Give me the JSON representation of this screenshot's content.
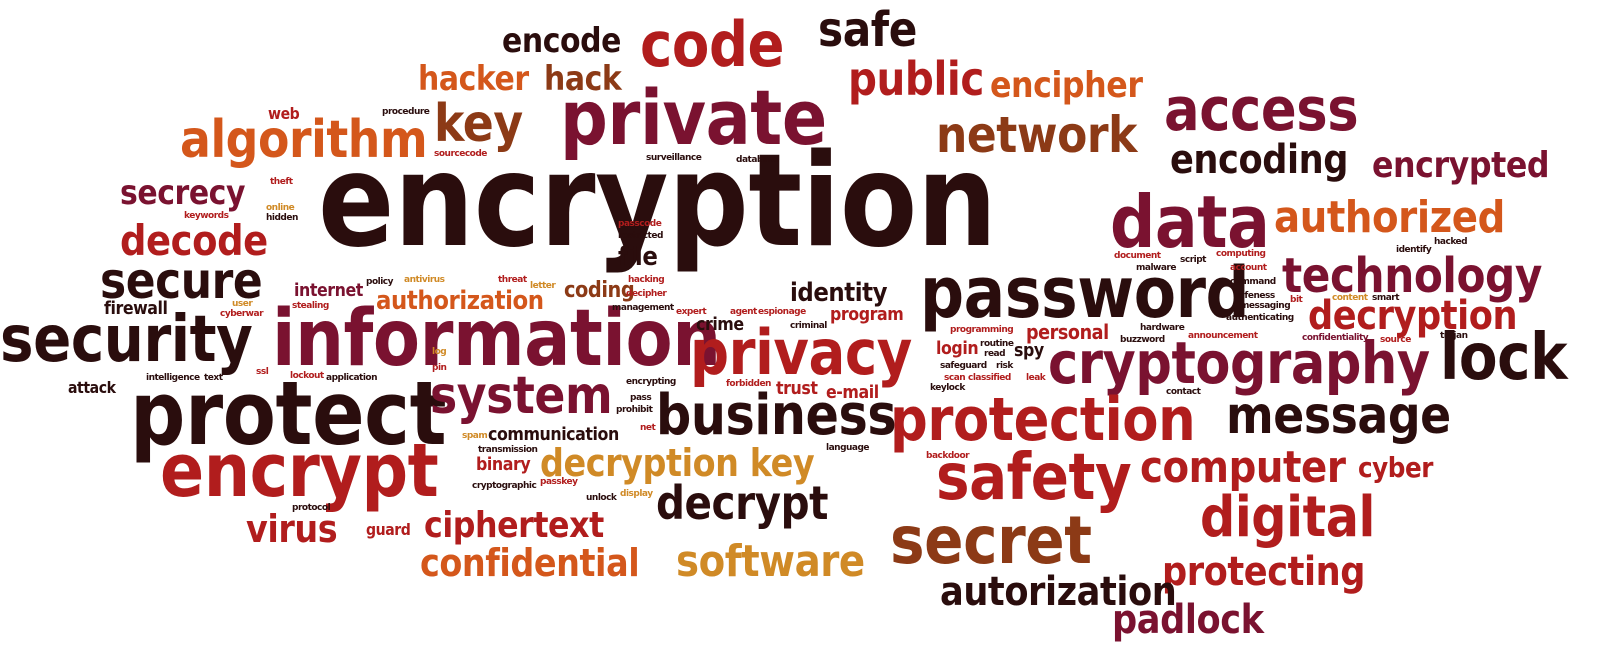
{
  "cloud": {
    "words": [
      {
        "text": "encryption",
        "color": "dark"
      },
      {
        "text": "encode",
        "color": "dark"
      },
      {
        "text": "code",
        "color": "red"
      },
      {
        "text": "safe",
        "color": "dark"
      },
      {
        "text": "hacker",
        "color": "orange"
      },
      {
        "text": "hack",
        "color": "brown"
      },
      {
        "text": "public",
        "color": "red"
      },
      {
        "text": "encipher",
        "color": "orange"
      },
      {
        "text": "private",
        "color": "maroon"
      },
      {
        "text": "key",
        "color": "brown"
      },
      {
        "text": "algorithm",
        "color": "orange"
      },
      {
        "text": "network",
        "color": "brown"
      },
      {
        "text": "access",
        "color": "maroon"
      },
      {
        "text": "encoding",
        "color": "dark"
      },
      {
        "text": "encrypted",
        "color": "maroon"
      },
      {
        "text": "secrecy",
        "color": "maroon"
      },
      {
        "text": "decode",
        "color": "red"
      },
      {
        "text": "secure",
        "color": "dark"
      },
      {
        "text": "data",
        "color": "maroon"
      },
      {
        "text": "authorized",
        "color": "orange"
      },
      {
        "text": "technology",
        "color": "maroon"
      },
      {
        "text": "password",
        "color": "dark"
      },
      {
        "text": "decryption",
        "color": "red"
      },
      {
        "text": "security",
        "color": "dark"
      },
      {
        "text": "information",
        "color": "maroon"
      },
      {
        "text": "privacy",
        "color": "red"
      },
      {
        "text": "cryptography",
        "color": "maroon"
      },
      {
        "text": "lock",
        "color": "dark"
      },
      {
        "text": "protect",
        "color": "dark"
      },
      {
        "text": "system",
        "color": "maroon"
      },
      {
        "text": "business",
        "color": "dark"
      },
      {
        "text": "protection",
        "color": "red"
      },
      {
        "text": "message",
        "color": "dark"
      },
      {
        "text": "encrypt",
        "color": "red"
      },
      {
        "text": "decryption key",
        "color": "gold"
      },
      {
        "text": "safety",
        "color": "red"
      },
      {
        "text": "computer",
        "color": "red"
      },
      {
        "text": "cyber",
        "color": "red"
      },
      {
        "text": "decrypt",
        "color": "dark"
      },
      {
        "text": "digital",
        "color": "red"
      },
      {
        "text": "virus",
        "color": "red"
      },
      {
        "text": "ciphertext",
        "color": "red"
      },
      {
        "text": "secret",
        "color": "brown"
      },
      {
        "text": "confidential",
        "color": "orange"
      },
      {
        "text": "software",
        "color": "gold"
      },
      {
        "text": "protecting",
        "color": "red"
      },
      {
        "text": "autorization",
        "color": "dark"
      },
      {
        "text": "padlock",
        "color": "maroon"
      },
      {
        "text": "file",
        "color": "dark"
      },
      {
        "text": "identity",
        "color": "dark"
      },
      {
        "text": "authorization",
        "color": "orange"
      },
      {
        "text": "coding",
        "color": "brown"
      },
      {
        "text": "internet",
        "color": "maroon"
      },
      {
        "text": "firewall",
        "color": "dark"
      },
      {
        "text": "program",
        "color": "red"
      },
      {
        "text": "personal",
        "color": "red"
      },
      {
        "text": "login",
        "color": "red"
      },
      {
        "text": "spy",
        "color": "dark"
      },
      {
        "text": "crime",
        "color": "dark"
      },
      {
        "text": "trust",
        "color": "red"
      },
      {
        "text": "e-mail",
        "color": "red"
      },
      {
        "text": "communication",
        "color": "dark"
      },
      {
        "text": "binary",
        "color": "red"
      },
      {
        "text": "attack",
        "color": "dark"
      },
      {
        "text": "guard",
        "color": "red"
      },
      {
        "text": "web",
        "color": "red"
      },
      {
        "text": "procedure",
        "color": "dark"
      },
      {
        "text": "sourcecode",
        "color": "red"
      },
      {
        "text": "surveillance",
        "color": "dark"
      },
      {
        "text": "database",
        "color": "dark"
      },
      {
        "text": "theft",
        "color": "red"
      },
      {
        "text": "keywords",
        "color": "red"
      },
      {
        "text": "online",
        "color": "gold"
      },
      {
        "text": "hidden",
        "color": "dark"
      },
      {
        "text": "passcode",
        "color": "red"
      },
      {
        "text": "restricted",
        "color": "dark"
      },
      {
        "text": "policy",
        "color": "dark"
      },
      {
        "text": "antivirus",
        "color": "gold"
      },
      {
        "text": "threat",
        "color": "red"
      },
      {
        "text": "letter",
        "color": "gold"
      },
      {
        "text": "hacking",
        "color": "red"
      },
      {
        "text": "decipher",
        "color": "red"
      },
      {
        "text": "user",
        "color": "gold"
      },
      {
        "text": "cyberwar",
        "color": "red"
      },
      {
        "text": "stealing",
        "color": "red"
      },
      {
        "text": "management",
        "color": "dark"
      },
      {
        "text": "expert",
        "color": "red"
      },
      {
        "text": "agent",
        "color": "red"
      },
      {
        "text": "espionage",
        "color": "red"
      },
      {
        "text": "criminal",
        "color": "dark"
      },
      {
        "text": "log",
        "color": "gold"
      },
      {
        "text": "pin",
        "color": "red"
      },
      {
        "text": "intelligence",
        "color": "dark"
      },
      {
        "text": "text",
        "color": "dark"
      },
      {
        "text": "ssl",
        "color": "red"
      },
      {
        "text": "lockout",
        "color": "red"
      },
      {
        "text": "application",
        "color": "dark"
      },
      {
        "text": "encrypting",
        "color": "dark"
      },
      {
        "text": "forbidden",
        "color": "red"
      },
      {
        "text": "pass",
        "color": "dark"
      },
      {
        "text": "prohibit",
        "color": "dark"
      },
      {
        "text": "spam",
        "color": "gold"
      },
      {
        "text": "net",
        "color": "red"
      },
      {
        "text": "transmission",
        "color": "dark"
      },
      {
        "text": "passkey",
        "color": "red"
      },
      {
        "text": "cryptographic",
        "color": "dark"
      },
      {
        "text": "protocol",
        "color": "dark"
      },
      {
        "text": "unlock",
        "color": "dark"
      },
      {
        "text": "display",
        "color": "gold"
      },
      {
        "text": "language",
        "color": "dark"
      },
      {
        "text": "backdoor",
        "color": "red"
      },
      {
        "text": "programming",
        "color": "red"
      },
      {
        "text": "routine",
        "color": "dark"
      },
      {
        "text": "read",
        "color": "dark"
      },
      {
        "text": "safeguard",
        "color": "dark"
      },
      {
        "text": "risk",
        "color": "dark"
      },
      {
        "text": "scan",
        "color": "red"
      },
      {
        "text": "classified",
        "color": "red"
      },
      {
        "text": "leak",
        "color": "red"
      },
      {
        "text": "keylock",
        "color": "dark"
      },
      {
        "text": "contact",
        "color": "dark"
      },
      {
        "text": "hardware",
        "color": "dark"
      },
      {
        "text": "buzzword",
        "color": "dark"
      },
      {
        "text": "announcement",
        "color": "red"
      },
      {
        "text": "confidentiality",
        "color": "maroon"
      },
      {
        "text": "source",
        "color": "red"
      },
      {
        "text": "trojan",
        "color": "dark"
      },
      {
        "text": "document",
        "color": "red"
      },
      {
        "text": "malware",
        "color": "dark"
      },
      {
        "text": "script",
        "color": "dark"
      },
      {
        "text": "computing",
        "color": "red"
      },
      {
        "text": "identify",
        "color": "dark"
      },
      {
        "text": "hacked",
        "color": "dark"
      },
      {
        "text": "account",
        "color": "red"
      },
      {
        "text": "command",
        "color": "dark"
      },
      {
        "text": "safeness",
        "color": "dark"
      },
      {
        "text": "messaging",
        "color": "dark"
      },
      {
        "text": "authenticating",
        "color": "dark"
      },
      {
        "text": "bit",
        "color": "red"
      },
      {
        "text": "content",
        "color": "gold"
      },
      {
        "text": "smart",
        "color": "dark"
      }
    ],
    "palette": {
      "dark": "#2a0d0d",
      "maroon": "#7a1230",
      "red": "#b11d1d",
      "orange": "#d4571b",
      "brown": "#8c3a16",
      "gold": "#d08a26"
    }
  }
}
